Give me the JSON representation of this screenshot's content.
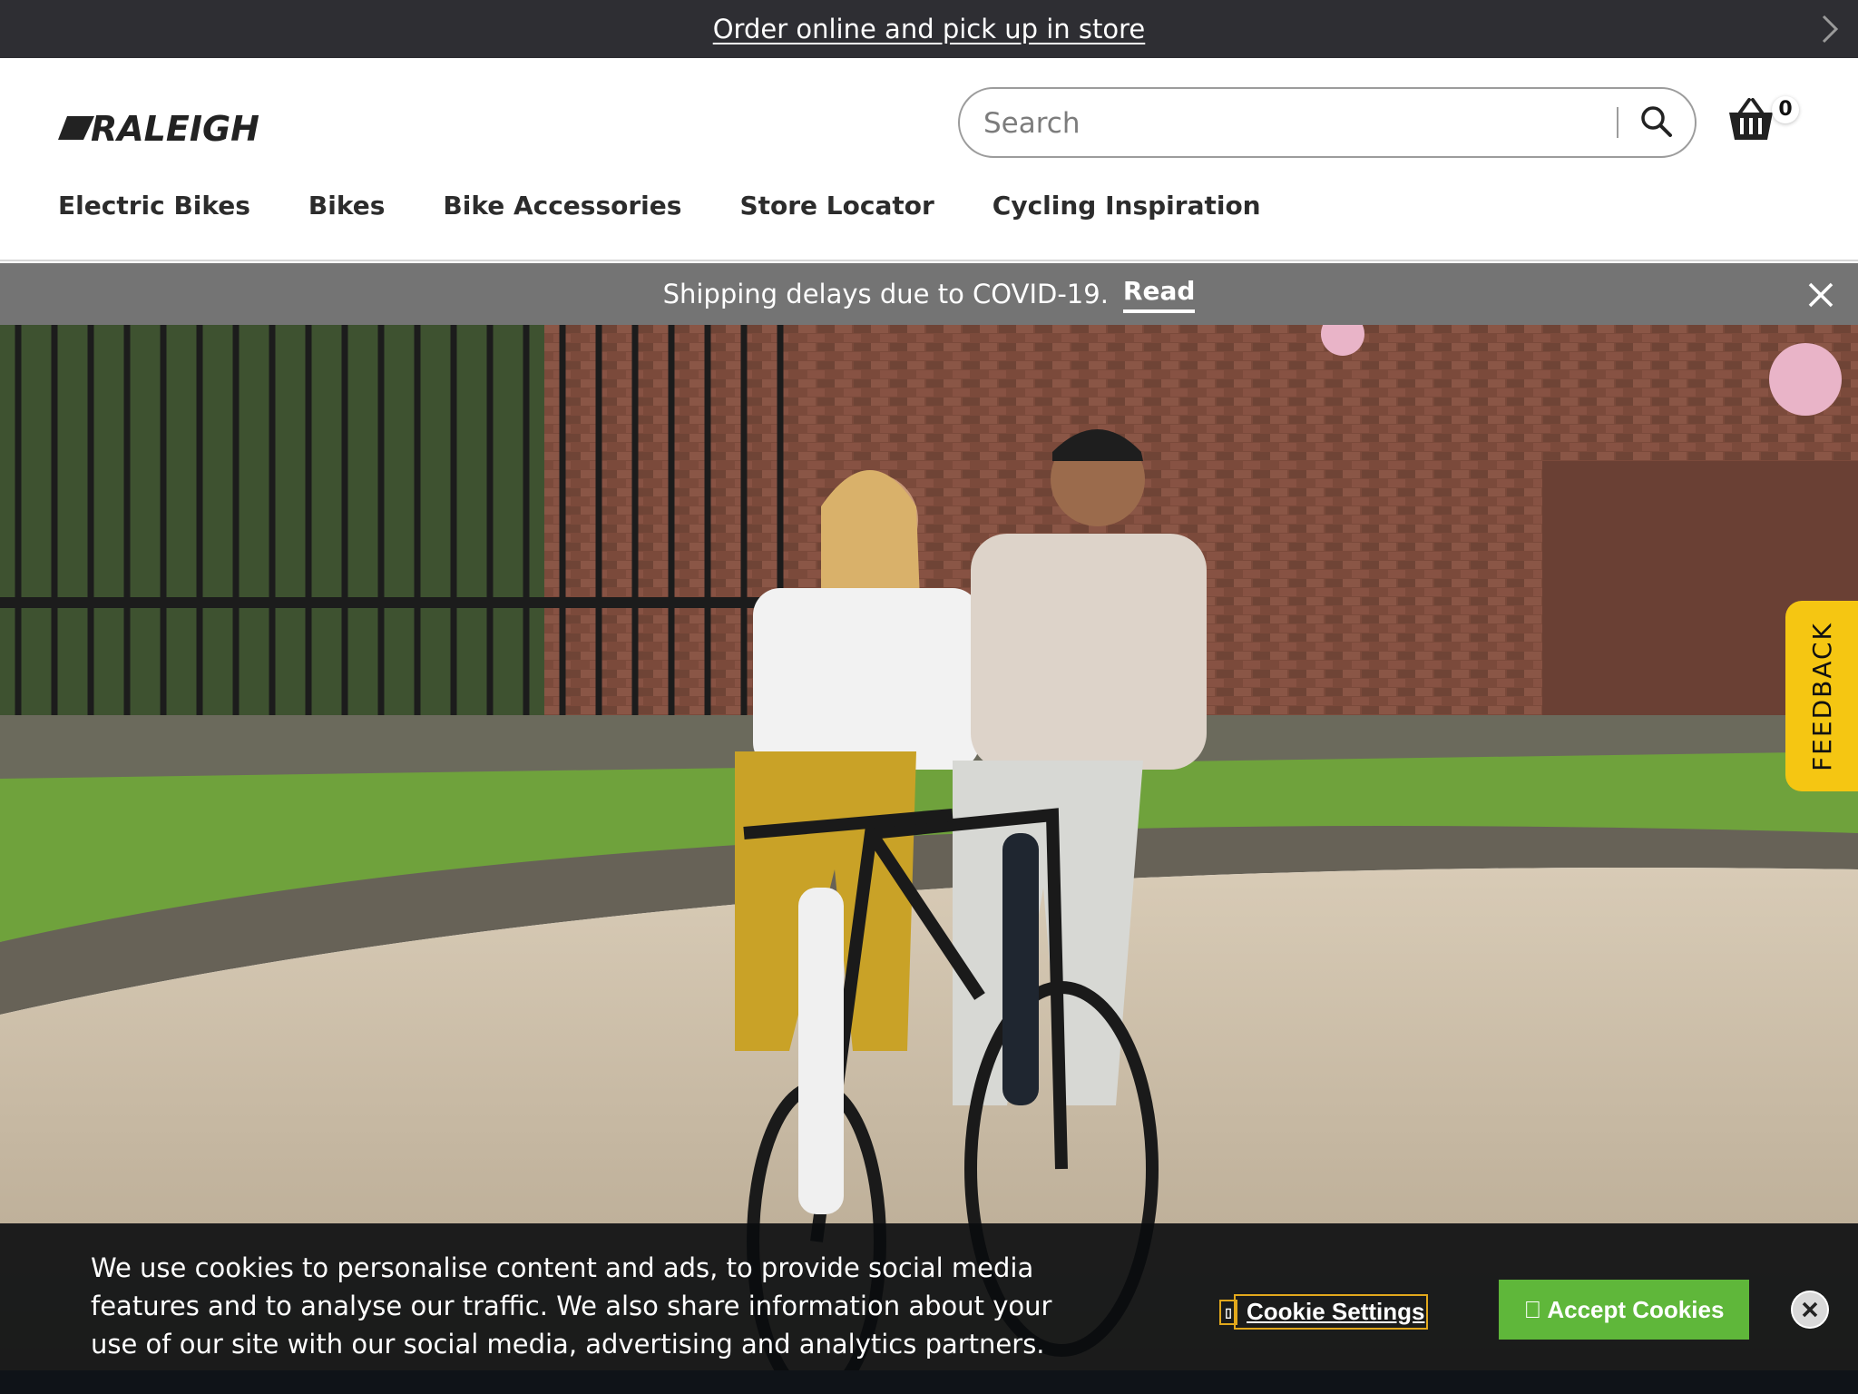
{
  "promo": {
    "text": "Order online and pick up in store",
    "next_icon": "chevron-right-icon"
  },
  "header": {
    "logo_text": "RALEIGH",
    "search_placeholder": "Search",
    "search_icon": "search-icon",
    "basket_icon": "basket-icon",
    "basket_count": "0",
    "nav": [
      "Electric Bikes",
      "Bikes",
      "Bike Accessories",
      "Store Locator",
      "Cycling Inspiration"
    ]
  },
  "notice": {
    "text": "Shipping delays due to COVID-19.",
    "link": "Read",
    "close_icon": "close-icon"
  },
  "feedback": {
    "label": "FEEDBACK"
  },
  "cookie": {
    "message": "We use cookies to personalise content and ads, to provide social media features and to analyse our traffic. We also share information about your use of our site with our social media, advertising and analytics partners.",
    "settings_label": "Cookie Settings",
    "accept_label": "\u0000 Accept Cookies",
    "close_icon": "close-icon"
  },
  "colors": {
    "promo_bg": "#2e2e33",
    "notice_bg": "#747474",
    "feedback_bg": "#f5c612",
    "accept_bg": "#5fb73a"
  }
}
